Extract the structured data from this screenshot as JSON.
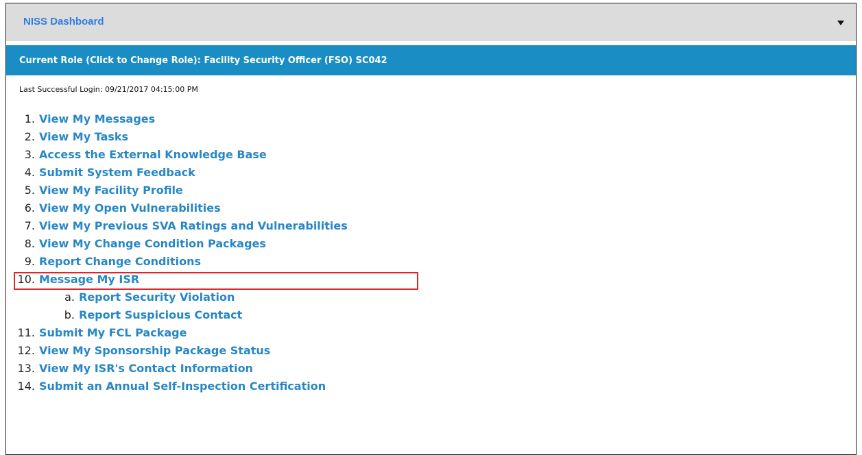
{
  "header": {
    "title": "NISS Dashboard"
  },
  "role": {
    "text": "Current Role (Click to Change Role): Facility Security Officer (FSO) SC042"
  },
  "login": {
    "text": "Last Successful Login: 09/21/2017 04:15:00 PM"
  },
  "menu": [
    {
      "num": "1.",
      "label": "View My Messages"
    },
    {
      "num": "2.",
      "label": "View My Tasks"
    },
    {
      "num": "3.",
      "label": "Access the External Knowledge Base"
    },
    {
      "num": "4.",
      "label": "Submit System Feedback"
    },
    {
      "num": "5.",
      "label": "View My Facility Profile"
    },
    {
      "num": "6.",
      "label": "View My Open Vulnerabilities"
    },
    {
      "num": "7.",
      "label": "View My Previous SVA Ratings and Vulnerabilities"
    },
    {
      "num": "8.",
      "label": "View My Change Condition Packages"
    },
    {
      "num": "9.",
      "label": "Report Change Conditions"
    },
    {
      "num": "10.",
      "label": "Message My ISR",
      "highlighted": true
    },
    {
      "num": "a.",
      "label": "Report Security Violation"
    },
    {
      "num": "b.",
      "label": "Report Suspicious Contact"
    },
    {
      "num": "11.",
      "label": "Submit My FCL Package"
    },
    {
      "num": "12.",
      "label": "View My Sponsorship Package Status"
    },
    {
      "num": "13.",
      "label": "View My ISR's Contact Information"
    },
    {
      "num": "14.",
      "label": "Submit an Annual Self-Inspection Certification"
    }
  ]
}
